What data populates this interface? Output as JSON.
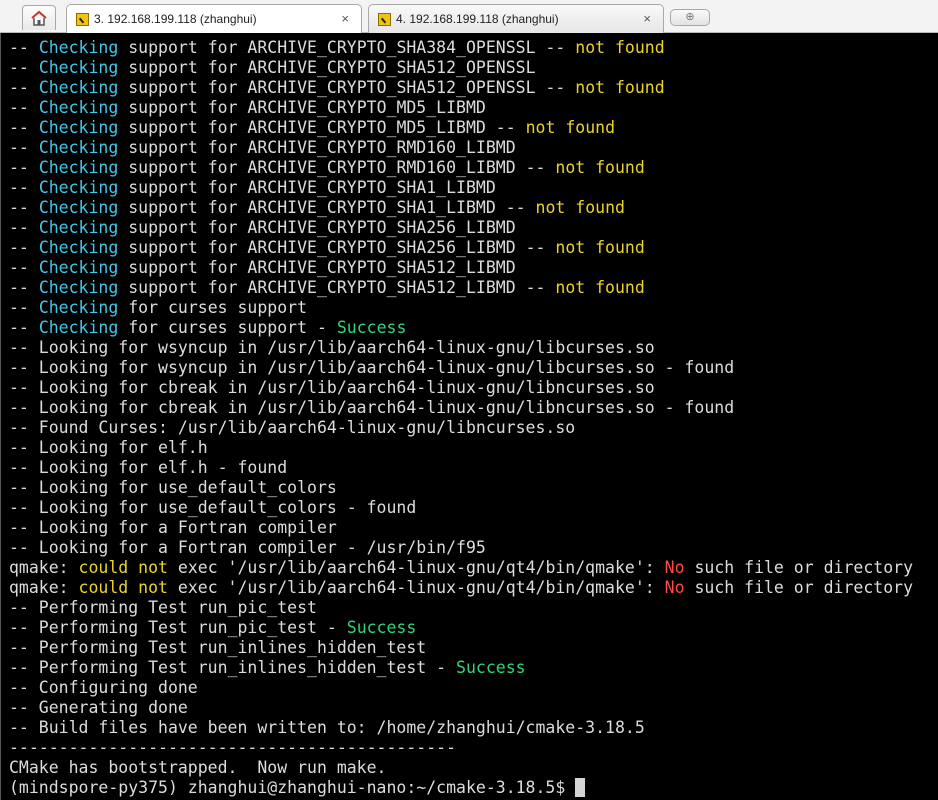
{
  "tabs": [
    {
      "label": "3. 192.168.199.118 (zhanghui)",
      "close": "×"
    },
    {
      "label": "4. 192.168.199.118 (zhanghui)",
      "close": "×"
    }
  ],
  "new_tab_glyph": "⊕",
  "icons": {
    "home": "home-icon",
    "session": "terminal-session-icon",
    "close": "close-icon"
  },
  "colors": {
    "cyan": "#3fc8e8",
    "yellow": "#ebd42a",
    "green": "#2fd67b",
    "red": "#ff4848",
    "text": "#dcdcdc",
    "background": "#000000"
  },
  "terminal": {
    "lines": [
      [
        {
          "t": "-- "
        },
        {
          "t": "Checking",
          "c": "cyan"
        },
        {
          "t": " support for ARCHIVE_CRYPTO_SHA384_OPENSSL -- "
        },
        {
          "t": "not found",
          "c": "yellow"
        }
      ],
      [
        {
          "t": "-- "
        },
        {
          "t": "Checking",
          "c": "cyan"
        },
        {
          "t": " support for ARCHIVE_CRYPTO_SHA512_OPENSSL"
        }
      ],
      [
        {
          "t": "-- "
        },
        {
          "t": "Checking",
          "c": "cyan"
        },
        {
          "t": " support for ARCHIVE_CRYPTO_SHA512_OPENSSL -- "
        },
        {
          "t": "not found",
          "c": "yellow"
        }
      ],
      [
        {
          "t": "-- "
        },
        {
          "t": "Checking",
          "c": "cyan"
        },
        {
          "t": " support for ARCHIVE_CRYPTO_MD5_LIBMD"
        }
      ],
      [
        {
          "t": "-- "
        },
        {
          "t": "Checking",
          "c": "cyan"
        },
        {
          "t": " support for ARCHIVE_CRYPTO_MD5_LIBMD -- "
        },
        {
          "t": "not found",
          "c": "yellow"
        }
      ],
      [
        {
          "t": "-- "
        },
        {
          "t": "Checking",
          "c": "cyan"
        },
        {
          "t": " support for ARCHIVE_CRYPTO_RMD160_LIBMD"
        }
      ],
      [
        {
          "t": "-- "
        },
        {
          "t": "Checking",
          "c": "cyan"
        },
        {
          "t": " support for ARCHIVE_CRYPTO_RMD160_LIBMD -- "
        },
        {
          "t": "not found",
          "c": "yellow"
        }
      ],
      [
        {
          "t": "-- "
        },
        {
          "t": "Checking",
          "c": "cyan"
        },
        {
          "t": " support for ARCHIVE_CRYPTO_SHA1_LIBMD"
        }
      ],
      [
        {
          "t": "-- "
        },
        {
          "t": "Checking",
          "c": "cyan"
        },
        {
          "t": " support for ARCHIVE_CRYPTO_SHA1_LIBMD -- "
        },
        {
          "t": "not found",
          "c": "yellow"
        }
      ],
      [
        {
          "t": "-- "
        },
        {
          "t": "Checking",
          "c": "cyan"
        },
        {
          "t": " support for ARCHIVE_CRYPTO_SHA256_LIBMD"
        }
      ],
      [
        {
          "t": "-- "
        },
        {
          "t": "Checking",
          "c": "cyan"
        },
        {
          "t": " support for ARCHIVE_CRYPTO_SHA256_LIBMD -- "
        },
        {
          "t": "not found",
          "c": "yellow"
        }
      ],
      [
        {
          "t": "-- "
        },
        {
          "t": "Checking",
          "c": "cyan"
        },
        {
          "t": " support for ARCHIVE_CRYPTO_SHA512_LIBMD"
        }
      ],
      [
        {
          "t": "-- "
        },
        {
          "t": "Checking",
          "c": "cyan"
        },
        {
          "t": " support for ARCHIVE_CRYPTO_SHA512_LIBMD -- "
        },
        {
          "t": "not found",
          "c": "yellow"
        }
      ],
      [
        {
          "t": "-- "
        },
        {
          "t": "Checking",
          "c": "cyan"
        },
        {
          "t": " for curses support"
        }
      ],
      [
        {
          "t": "-- "
        },
        {
          "t": "Checking",
          "c": "cyan"
        },
        {
          "t": " for curses support - "
        },
        {
          "t": "Success",
          "c": "green"
        }
      ],
      [
        {
          "t": "-- Looking for wsyncup in /usr/lib/aarch64-linux-gnu/libcurses.so"
        }
      ],
      [
        {
          "t": "-- Looking for wsyncup in /usr/lib/aarch64-linux-gnu/libcurses.so - found"
        }
      ],
      [
        {
          "t": "-- Looking for cbreak in /usr/lib/aarch64-linux-gnu/libncurses.so"
        }
      ],
      [
        {
          "t": "-- Looking for cbreak in /usr/lib/aarch64-linux-gnu/libncurses.so - found"
        }
      ],
      [
        {
          "t": "-- Found Curses: /usr/lib/aarch64-linux-gnu/libncurses.so"
        }
      ],
      [
        {
          "t": "-- Looking for elf.h"
        }
      ],
      [
        {
          "t": "-- Looking for elf.h - found"
        }
      ],
      [
        {
          "t": "-- Looking for use_default_colors"
        }
      ],
      [
        {
          "t": "-- Looking for use_default_colors - found"
        }
      ],
      [
        {
          "t": "-- Looking for a Fortran compiler"
        }
      ],
      [
        {
          "t": "-- Looking for a Fortran compiler - /usr/bin/f95"
        }
      ],
      [
        {
          "t": "qmake: "
        },
        {
          "t": "could not",
          "c": "yellow"
        },
        {
          "t": " exec '/usr/lib/aarch64-linux-gnu/qt4/bin/qmake': "
        },
        {
          "t": "No",
          "c": "red"
        },
        {
          "t": " such file or directory"
        }
      ],
      [
        {
          "t": "qmake: "
        },
        {
          "t": "could not",
          "c": "yellow"
        },
        {
          "t": " exec '/usr/lib/aarch64-linux-gnu/qt4/bin/qmake': "
        },
        {
          "t": "No",
          "c": "red"
        },
        {
          "t": " such file or directory"
        }
      ],
      [
        {
          "t": "-- Performing Test run_pic_test"
        }
      ],
      [
        {
          "t": "-- Performing Test run_pic_test - "
        },
        {
          "t": "Success",
          "c": "green"
        }
      ],
      [
        {
          "t": "-- Performing Test run_inlines_hidden_test"
        }
      ],
      [
        {
          "t": "-- Performing Test run_inlines_hidden_test - "
        },
        {
          "t": "Success",
          "c": "green"
        }
      ],
      [
        {
          "t": "-- Configuring done"
        }
      ],
      [
        {
          "t": "-- Generating done"
        }
      ],
      [
        {
          "t": "-- Build files have been written to: /home/zhanghui/cmake-3.18.5"
        }
      ],
      [
        {
          "t": "---------------------------------------------"
        }
      ],
      [
        {
          "t": "CMake has bootstrapped.  Now run make."
        }
      ],
      [
        {
          "t": "(mindspore-py375) zhanghui@zhanghui-nano:~/cmake-3.18.5$ "
        }
      ]
    ]
  }
}
